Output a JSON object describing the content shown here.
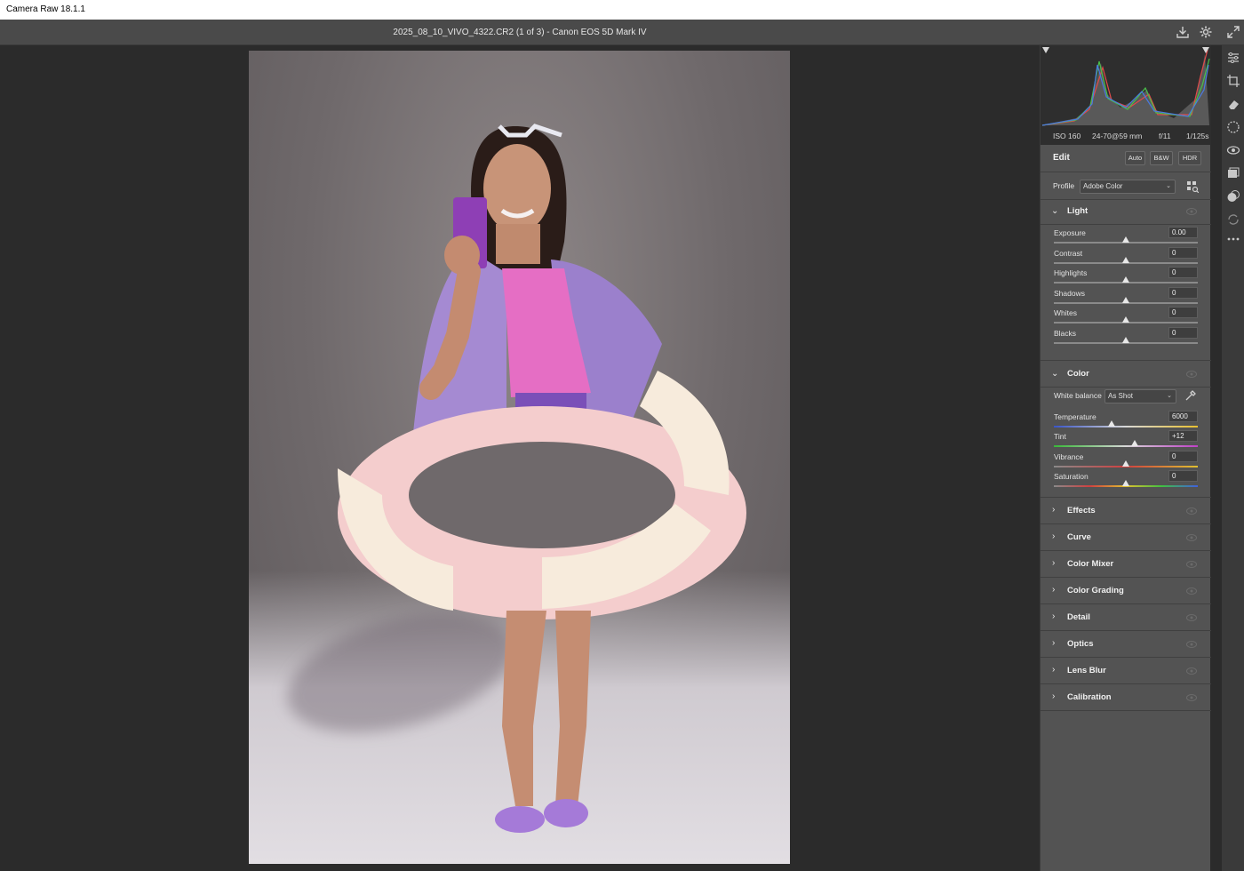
{
  "window": {
    "title": "Camera Raw 18.1.1"
  },
  "topbar": {
    "filename": "2025_08_10_VIVO_4322.CR2 (1 of 3)  -  Canon EOS 5D Mark IV"
  },
  "meta": {
    "iso": "ISO 160",
    "lens": "24-70@59 mm",
    "aperture": "f/11",
    "shutter": "1/125s"
  },
  "edit": {
    "title": "Edit",
    "auto": "Auto",
    "bw": "B&W",
    "hdr": "HDR"
  },
  "profile": {
    "label": "Profile",
    "value": "Adobe Color"
  },
  "light": {
    "title": "Light",
    "sliders": [
      {
        "label": "Exposure",
        "value": "0.00",
        "pos": 0.5
      },
      {
        "label": "Contrast",
        "value": "0",
        "pos": 0.5
      },
      {
        "label": "Highlights",
        "value": "0",
        "pos": 0.5
      },
      {
        "label": "Shadows",
        "value": "0",
        "pos": 0.5
      },
      {
        "label": "Whites",
        "value": "0",
        "pos": 0.5
      },
      {
        "label": "Blacks",
        "value": "0",
        "pos": 0.5
      }
    ]
  },
  "color": {
    "title": "Color",
    "wb_label": "White balance",
    "wb_value": "As Shot",
    "sliders": [
      {
        "label": "Temperature",
        "value": "6000",
        "pos": 0.4
      },
      {
        "label": "Tint",
        "value": "+12",
        "pos": 0.56
      },
      {
        "label": "Vibrance",
        "value": "0",
        "pos": 0.5
      },
      {
        "label": "Saturation",
        "value": "0",
        "pos": 0.5
      }
    ]
  },
  "sections": [
    "Effects",
    "Curve",
    "Color Mixer",
    "Color Grading",
    "Detail",
    "Optics",
    "Lens Blur",
    "Calibration"
  ]
}
